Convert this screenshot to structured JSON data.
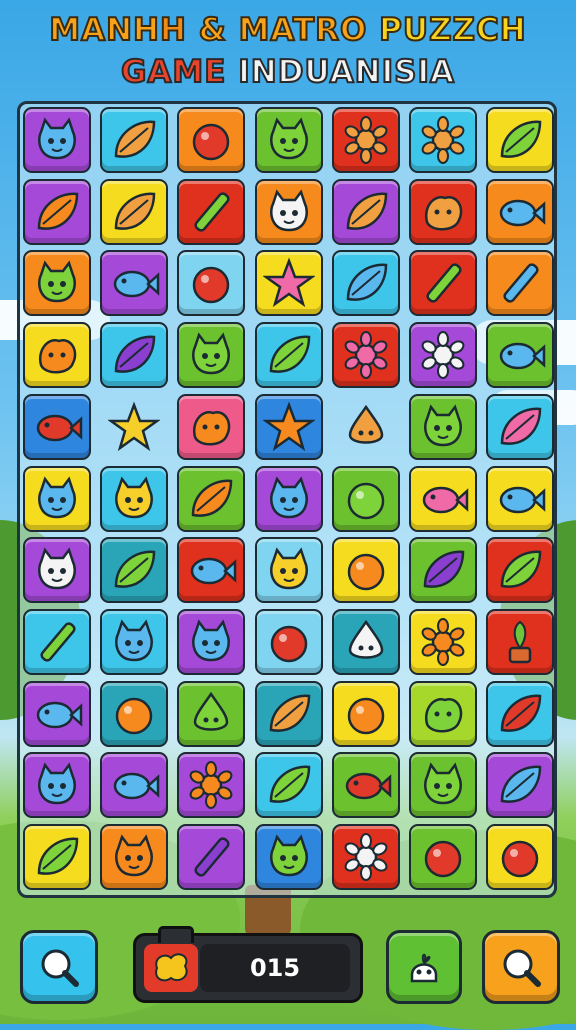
{
  "title": {
    "line1_part1": "MANH",
    "line1_part2": "H",
    "line1_part3": " & MATRO ",
    "line1_part4": "PUZZCH",
    "line2_part1": "GAM",
    "line2_part2": "E",
    "line2_part3": " INDUANISIA"
  },
  "colors": {
    "purple": "#a54ad8",
    "cyan": "#3dc6ea",
    "orange": "#f78a1c",
    "green": "#6cc12f",
    "red": "#e0301e",
    "yellow": "#f5dc1e",
    "pink": "#ee5a8a",
    "blue": "#2f86df",
    "lime": "#a6d82c",
    "teal": "#2aa5b8",
    "lightblue": "#7fd4f0",
    "empty": "transparent"
  },
  "grid": {
    "rows": 11,
    "cols": 7,
    "tiles": [
      [
        "purple:blue-cat-icon",
        "cyan:leaf-icon",
        "orange:red-blob-icon",
        "green:green-face-icon",
        "red:rose-icon",
        "cyan:flower-icon",
        "yellow:green-bean-icon"
      ],
      [
        "purple:orange-leaf-icon",
        "yellow:seed-pod-icon",
        "red:green-pen-icon",
        "orange:white-cat-icon",
        "purple:eggplant-icon",
        "red:creature-icon",
        "orange:blue-fish-icon"
      ],
      [
        "orange:green-cat-icon",
        "purple:blue-bird-icon",
        "lightblue:red-fruit-icon",
        "yellow:pink-star-icon",
        "cyan:blue-leaf-icon",
        "red:green-pen-icon",
        "orange:blue-pen-icon"
      ],
      [
        "yellow:orange-bow-icon",
        "cyan:purple-leaf-icon",
        "green:green-face-icon",
        "cyan:green-leaf-icon",
        "red:pink-flower-icon",
        "purple:white-burst-icon",
        "green:blue-bird-icon"
      ],
      [
        "blue:red-fish-icon",
        "empty:yellow-star-creature-icon",
        "pink:orange-glove-icon",
        "blue:orange-star-icon",
        "empty:ghost-icon",
        "green:green-face-icon",
        "cyan:pink-leaf-icon"
      ],
      [
        "yellow:blue-face-icon",
        "cyan:yellow-face-icon",
        "green:orange-leaf-icon",
        "purple:blue-cat-icon",
        "green:green-oval-icon",
        "yellow:pink-fish-icon",
        "yellow:blue-fish-icon"
      ],
      [
        "purple:white-cat-icon",
        "teal:green-leaf-icon",
        "red:blue-bird-icon",
        "lightblue:yellow-face-icon",
        "yellow:orange-blob-icon",
        "green:purple-eggplant-icon",
        "red:green-leaf-icon"
      ],
      [
        "cyan:green-stick-icon",
        "cyan:blue-face-icon",
        "purple:blue-cat-icon",
        "lightblue:red-ball-icon",
        "teal:white-drop-icon",
        "yellow:orange-burst-icon",
        "red:green-plant-icon"
      ],
      [
        "purple:blue-fish-icon",
        "teal:orange-blob-icon",
        "green:green-drop-icon",
        "teal:seed-pod-icon",
        "yellow:orange-ball-icon",
        "lime:green-lizard-icon",
        "cyan:red-leaf-icon"
      ],
      [
        "purple:blue-cat-icon",
        "purple:blue-bird-icon",
        "purple:orange-sun-icon",
        "cyan:green-leaf-icon",
        "green:red-bird-icon",
        "green:green-face-icon",
        "purple:blue-leaf-icon"
      ],
      [
        "yellow:green-leaf-icon",
        "orange:orange-cat-icon",
        "purple:purple-stick-icon",
        "blue:green-face-icon",
        "red:white-burst-icon",
        "green:red-blob-icon",
        "yellow:red-ball-icon"
      ]
    ]
  },
  "bottom_bar": {
    "left_button_icon": "magnifier-icon",
    "score_value": "015",
    "score_icon": "yellow-blob-icon",
    "hint_button_icon": "plant-creature-icon",
    "right_button_icon": "magnifier-icon"
  }
}
